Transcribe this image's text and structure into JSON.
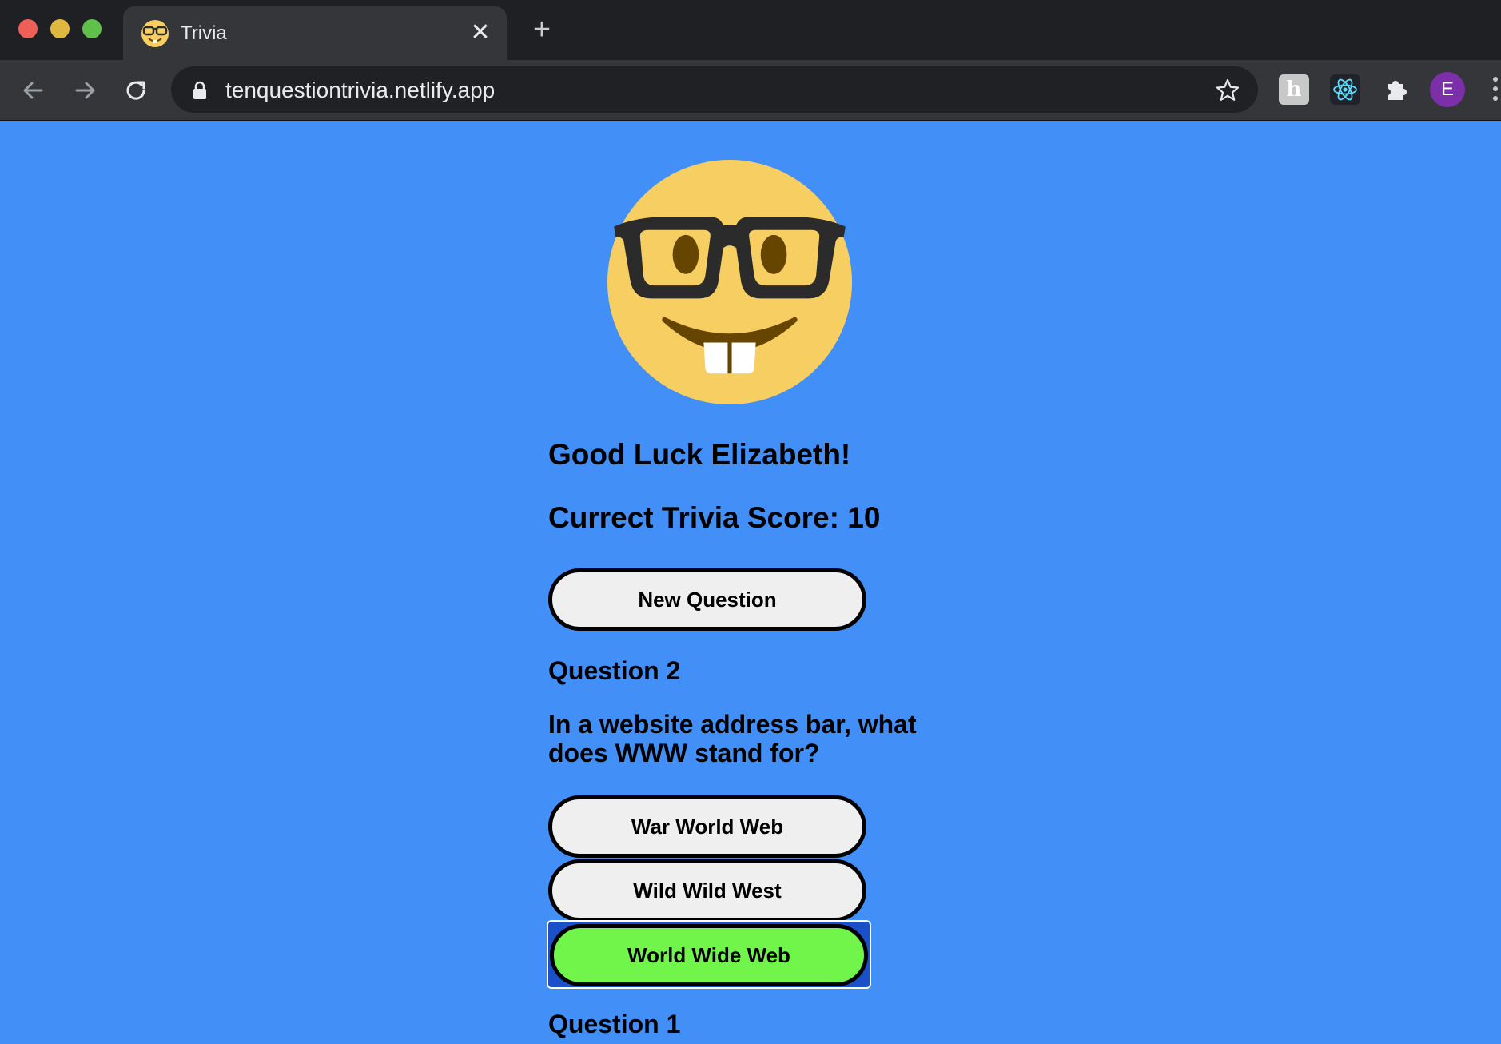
{
  "browser": {
    "tab_title": "Trivia",
    "url": "tenquestiontrivia.netlify.app",
    "profile_initial": "E",
    "extension_h_label": "h"
  },
  "page": {
    "greeting": "Good Luck Elizabeth!",
    "score_text": "Currect Trivia Score: 10",
    "new_question_label": "New Question",
    "question2": {
      "title": "Question 2",
      "text": "In a website address bar, what does WWW stand for?",
      "answers": [
        "War World Web",
        "Wild Wild West",
        "World Wide Web"
      ],
      "selected_answer_color": "#72f54a"
    },
    "question1_title": "Question 1",
    "background_color": "#418ff7"
  }
}
